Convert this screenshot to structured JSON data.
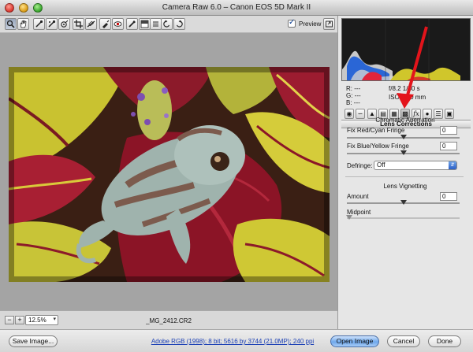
{
  "window": {
    "title": "Camera Raw 6.0  –  Canon EOS 5D Mark II"
  },
  "toolbar": {
    "tools": [
      "zoom-icon",
      "hand-icon",
      "white-balance-icon",
      "color-sampler-icon",
      "target-adjust-icon",
      "crop-icon",
      "straighten-icon",
      "spot-removal-icon",
      "red-eye-icon",
      "adjustment-brush-icon",
      "graduated-filter-icon",
      "open-preferences-icon",
      "rotate-left-icon",
      "rotate-right-icon"
    ],
    "preview_label": "Preview",
    "preview_checked": true
  },
  "status": {
    "zoom_value": "12.5%",
    "filename": "_MG_2412.CR2",
    "zoom_out": "−",
    "zoom_in": "+"
  },
  "panel": {
    "rgb": {
      "r": "R:  ---",
      "g": "G:  ---",
      "b": "B:  ---"
    },
    "exif": {
      "line1": "f/8.2   1/60 s",
      "line2": "ISO 2      50 mm"
    },
    "tabs": [
      "basic-icon",
      "tone-curve-icon",
      "detail-icon",
      "hsl-icon",
      "split-toning-icon",
      "lens-corrections-icon",
      "effects-icon",
      "camera-calibration-icon",
      "presets-icon",
      "snapshots-icon"
    ],
    "active_tab": "lens-corrections-icon",
    "header": "Lens Corrections",
    "chromatic_aberration": {
      "title": "Chromatic Aberration",
      "red_cyan_label": "Fix Red/Cyan Fringe",
      "red_cyan_value": "0",
      "blue_yellow_label": "Fix Blue/Yellow Fringe",
      "blue_yellow_value": "0",
      "defringe_label": "Defringe:",
      "defringe_value": "Off"
    },
    "lens_vignetting": {
      "title": "Lens Vignetting",
      "amount_label": "Amount",
      "amount_value": "0",
      "midpoint_label": "Midpoint"
    }
  },
  "footer": {
    "save_label": "Save Image...",
    "workflow_link": "Adobe RGB (1998); 8 bit; 5616 by 3744 (21.0MP); 240 ppi",
    "open_label": "Open Image",
    "cancel_label": "Cancel",
    "done_label": "Done"
  },
  "colors": {
    "accent": "#2b5fc6",
    "annotation_arrow": "#e3141b"
  }
}
